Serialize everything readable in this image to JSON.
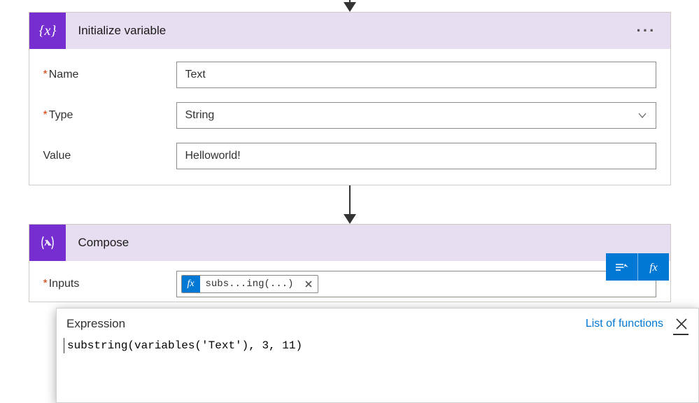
{
  "actions": {
    "init_var": {
      "title": "Initialize variable",
      "fields": {
        "name_label": "Name",
        "name_value": "Text",
        "type_label": "Type",
        "type_value": "String",
        "value_label": "Value",
        "value_value": "Helloworld!"
      }
    },
    "compose": {
      "title": "Compose",
      "inputs_label": "Inputs",
      "token_label": "subs...ing(...)"
    }
  },
  "expression_panel": {
    "title": "Expression",
    "link_text": "List of functions",
    "input_value": "substring(variables('Text'), 3, 11)"
  }
}
